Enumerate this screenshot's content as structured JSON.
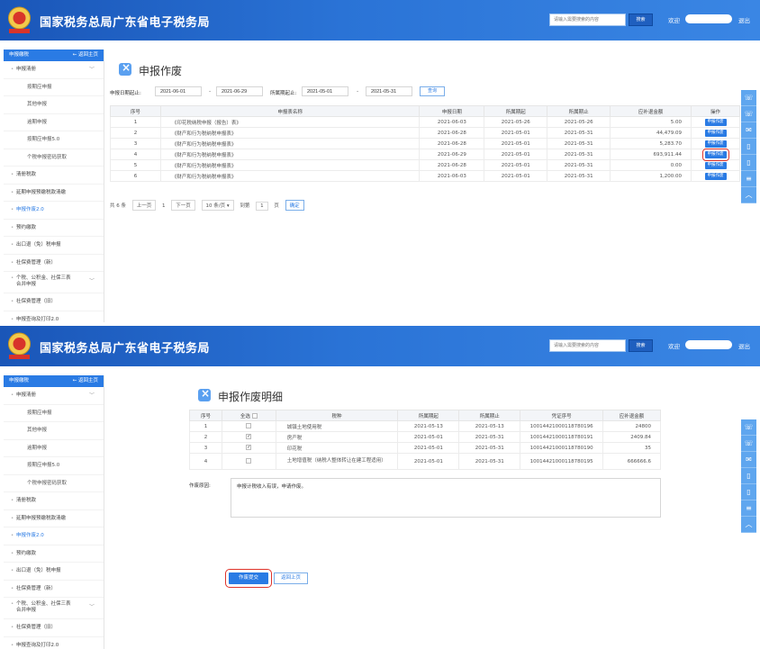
{
  "site_title": "国家税务总局广东省电子税务局",
  "search_placeholder": "请输入需要搜索的内容",
  "search_label": "搜索",
  "welcome": "欢迎",
  "logout": "退出",
  "sidebar": {
    "header": "申报缴税",
    "home": "返回主页",
    "items": [
      {
        "label": "申报清册"
      },
      {
        "label": "按期应申报"
      },
      {
        "label": "其他申报"
      },
      {
        "label": "逾期申报"
      },
      {
        "label": "按期应申报5.0"
      },
      {
        "label": "个税申报密码获取"
      },
      {
        "label": "清册税款"
      },
      {
        "label": "延期申报预缴税款清缴"
      },
      {
        "label": "申报作废2.0"
      },
      {
        "label": "预约缴款"
      },
      {
        "label": "出口退（免）税申报"
      },
      {
        "label": "社保费管理（新）"
      },
      {
        "label": "个税、公积金、社保三表合并申报"
      },
      {
        "label": "社保费管理（旧）"
      },
      {
        "label": "申报查询及打印2.0"
      }
    ]
  },
  "right_toolbar": [
    "☏",
    "☏",
    "✉",
    "▯",
    "▯",
    "≡",
    "︿"
  ],
  "panel1": {
    "title": "申报作废",
    "filter": {
      "date_label": "申报日期起止:",
      "date_from": "2021-06-01",
      "date_to": "2021-06-29",
      "period_label": "所属期起止:",
      "period_from": "2021-05-01",
      "period_to": "2021-05-31",
      "separator": "-",
      "query_btn": "查询"
    },
    "columns": [
      "序号",
      "申报表名称",
      "申报日期",
      "所属期起",
      "所属期止",
      "应补退金额",
      "操作"
    ],
    "rows": [
      {
        "no": "1",
        "name": "《印花税纳税申报（报告）表》",
        "date": "2021-06-03",
        "from": "2021-05-26",
        "to": "2021-05-26",
        "amount": "5.00",
        "action": "申报作废"
      },
      {
        "no": "2",
        "name": "《财产和行为税纳税申报表》",
        "date": "2021-06-28",
        "from": "2021-05-01",
        "to": "2021-05-31",
        "amount": "44,479.09",
        "action": "申报作废"
      },
      {
        "no": "3",
        "name": "《财产和行为税纳税申报表》",
        "date": "2021-06-28",
        "from": "2021-05-01",
        "to": "2021-05-31",
        "amount": "5,283.70",
        "action": "申报作废"
      },
      {
        "no": "4",
        "name": "《财产和行为税纳税申报表》",
        "date": "2021-06-29",
        "from": "2021-05-01",
        "to": "2021-05-31",
        "amount": "693,911.44",
        "action": "申报作废"
      },
      {
        "no": "5",
        "name": "《财产和行为税纳税申报表》",
        "date": "2021-06-28",
        "from": "2021-05-01",
        "to": "2021-05-31",
        "amount": "0.00",
        "action": "申报作废"
      },
      {
        "no": "6",
        "name": "《财产和行为税纳税申报表》",
        "date": "2021-06-03",
        "from": "2021-05-01",
        "to": "2021-05-31",
        "amount": "1,200.00",
        "action": "申报作废"
      }
    ],
    "pager": {
      "total": "共 6 条",
      "prev": "上一页",
      "page": "1",
      "next": "下一页",
      "per_page": "10 条/页 ▾",
      "goto": "到第",
      "goto_value": "1",
      "unit": "页",
      "confirm": "确定"
    }
  },
  "panel2": {
    "title": "申报作废明细",
    "columns": [
      "序号",
      "全选",
      "税种",
      "所属期起",
      "所属期止",
      "凭证序号",
      "应补退金额"
    ],
    "rows": [
      {
        "no": "1",
        "checked": "",
        "tax": "城镇土地使用税",
        "from": "2021-05-13",
        "to": "2021-05-13",
        "voucher": "10014421000118780196",
        "amount": "24800"
      },
      {
        "no": "2",
        "checked": "✓",
        "tax": "房产税",
        "from": "2021-05-01",
        "to": "2021-05-31",
        "voucher": "10014421000118780191",
        "amount": "2409.84"
      },
      {
        "no": "3",
        "checked": "✓",
        "tax": "印花税",
        "from": "2021-05-01",
        "to": "2021-05-31",
        "voucher": "10014421000118780190",
        "amount": "35"
      },
      {
        "no": "4",
        "checked": "",
        "tax": "土地增值税（纳税人整体转让在建工程适用）",
        "from": "2021-05-01",
        "to": "2021-05-31",
        "voucher": "10014421000118780195",
        "amount": "666666.6"
      }
    ],
    "reason_label": "作废原因:",
    "reason_text": "申报计税收入有误，申请作废。",
    "submit_btn": "作废提交",
    "back_btn": "返回上页"
  }
}
